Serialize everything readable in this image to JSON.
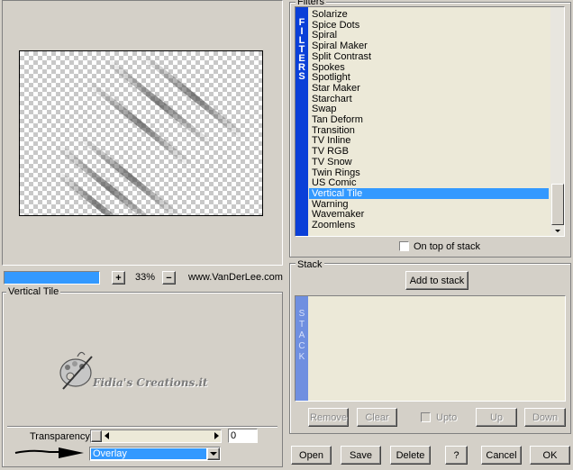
{
  "preview": {
    "zoom_value": "33%",
    "zoom_in_label": "+",
    "zoom_out_label": "−",
    "website": "www.VanDerLee.com"
  },
  "filter_panel": {
    "title": "Vertical Tile",
    "watermark": "Fidia's Creations.it"
  },
  "controls": {
    "transparency_label": "Transparency",
    "transparency_value": "0",
    "blend_mode": "Overlay"
  },
  "filters": {
    "group_label": "Filters",
    "side_text": [
      "F",
      "I",
      "L",
      "T",
      "E",
      "R",
      "S"
    ],
    "items": [
      "Solarize",
      "Spice Dots",
      "Spiral",
      "Spiral Maker",
      "Split Contrast",
      "Spokes",
      "Spotlight",
      "Star Maker",
      "Starchart",
      "Swap",
      "Tan Deform",
      "Transition",
      "TV Inline",
      "TV RGB",
      "TV Snow",
      "Twin Rings",
      "US Comic",
      "Vertical Tile",
      "Warning",
      "Wavemaker",
      "Zoomlens"
    ],
    "selected": "Vertical Tile",
    "on_top_label": "On top of stack"
  },
  "stack": {
    "group_label": "Stack",
    "add_label": "Add to stack",
    "side_text": [
      "S",
      "T",
      "A",
      "C",
      "K"
    ],
    "remove_label": "Remove",
    "clear_label": "Clear",
    "upto_label": "Upto",
    "up_label": "Up",
    "down_label": "Down"
  },
  "footer": {
    "open": "Open",
    "save": "Save",
    "delete": "Delete",
    "help": "?",
    "cancel": "Cancel",
    "ok": "OK"
  },
  "colors": {
    "accent": "#3399ff",
    "banner": "#0a3fd8",
    "stack_banner": "#6f8fe0",
    "face": "#d4d0c8",
    "list_bg": "#ece9d8"
  }
}
